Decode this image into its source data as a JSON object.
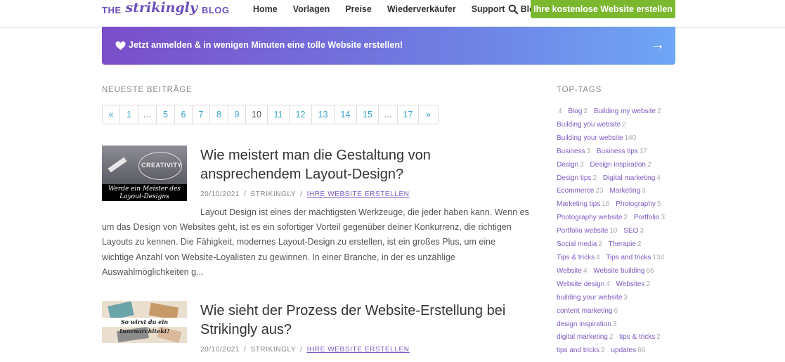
{
  "header": {
    "logo": {
      "prefix": "THE",
      "brand": "strikingly",
      "suffix": "BLOG"
    },
    "nav": [
      "Home",
      "Vorlagen",
      "Preise",
      "Wiederverkäufer",
      "Support",
      "Blog"
    ],
    "cta_label": "Ihre kostenlose Website erstellen"
  },
  "banner": {
    "text": "Jetzt anmelden & in wenigen Minuten eine tolle Website erstellen!",
    "arrow": "→"
  },
  "main": {
    "section_title": "NEUESTE BEITRÄGE",
    "pagination": [
      "«",
      "1",
      "…",
      "5",
      "6",
      "7",
      "8",
      "9",
      "10",
      "11",
      "12",
      "13",
      "14",
      "15",
      "…",
      "17",
      "»"
    ],
    "current_page": "10",
    "posts": [
      {
        "thumb_text": "Werde ein Meister des Layout-Designs",
        "thumb_overlay": "CREATIVITY",
        "title": "Wie meistert man die Gestaltung von ansprechendem Layout-Design?",
        "date": "20/10/2021",
        "author": "STRIKINGLY",
        "category": "IHRE WEBSITE ERSTELLEN",
        "excerpt": "Layout Design ist eines der mächtigsten Werkzeuge, die jeder haben kann. Wenn es um das Design von Websites geht, ist es ein sofortiger Vorteil gegenüber deiner Konkurrenz, die richtigen Layouts zu kennen. Die Fähigkeit, modernes Layout-Design zu erstellen, ist ein großes Plus, um eine wichtige Anzahl von Website-Loyalisten zu gewinnen. In einer Branche, in der es unzählige Auswahlmöglichkeiten g..."
      },
      {
        "thumb_text": "So wirst du ein Innenarchitekt!",
        "title": "Wie sieht der Prozess der Website-Erstellung bei Strikingly aus?",
        "date": "20/10/2021",
        "author": "STRIKINGLY",
        "category": "IHRE WEBSITE ERSTELLEN"
      }
    ]
  },
  "sidebar": {
    "title": "TOP-TAGS",
    "tags": [
      {
        "name": "",
        "count": "4"
      },
      {
        "name": "Blog",
        "count": "2"
      },
      {
        "name": "Building my website",
        "count": "2"
      },
      {
        "name": "Building you website",
        "count": "2"
      },
      {
        "name": "Building your website",
        "count": "140"
      },
      {
        "name": "Business",
        "count": "3"
      },
      {
        "name": "Business tips",
        "count": "17"
      },
      {
        "name": "Design",
        "count": "3"
      },
      {
        "name": "Design inspiration",
        "count": "2"
      },
      {
        "name": "Design tips",
        "count": "2"
      },
      {
        "name": "Digital marketing",
        "count": "4"
      },
      {
        "name": "Ecommerce",
        "count": "23"
      },
      {
        "name": "Marketing",
        "count": "3"
      },
      {
        "name": "Marketing tips",
        "count": "16"
      },
      {
        "name": "Photography",
        "count": "5"
      },
      {
        "name": "Photography website",
        "count": "2"
      },
      {
        "name": "Portfolio",
        "count": "3"
      },
      {
        "name": "Portfolio website",
        "count": "10"
      },
      {
        "name": "SEO",
        "count": "3"
      },
      {
        "name": "Social media",
        "count": "2"
      },
      {
        "name": "Therapie",
        "count": "2"
      },
      {
        "name": "Tips & tricks",
        "count": "4"
      },
      {
        "name": "Tips and tricks",
        "count": "134"
      },
      {
        "name": "Website",
        "count": "4"
      },
      {
        "name": "Website building",
        "count": "66"
      },
      {
        "name": "Website design",
        "count": "4"
      },
      {
        "name": "Websites",
        "count": "2"
      },
      {
        "name": "building your website",
        "count": "3"
      },
      {
        "name": "content marketing",
        "count": "6"
      },
      {
        "name": "design inspiration",
        "count": "3"
      },
      {
        "name": "digital marketing",
        "count": "2"
      },
      {
        "name": "tips & tricks",
        "count": "2"
      },
      {
        "name": "tips and tricks",
        "count": "2"
      },
      {
        "name": "updates",
        "count": "66"
      }
    ]
  },
  "colors": {
    "brand": "#6b4fbb",
    "cta": "#7cb82f",
    "link": "#7c59c2",
    "page_link": "#3aa0c8"
  },
  "icons": {
    "search": "search-icon",
    "heart": "heart-icon",
    "arrow": "arrow-right-icon"
  }
}
